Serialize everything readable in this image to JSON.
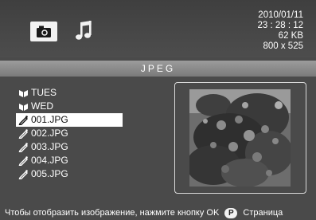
{
  "header": {
    "tabs": [
      {
        "icon": "camera-icon",
        "active": true
      },
      {
        "icon": "music-note-icon",
        "active": false
      }
    ],
    "date": "2010/01/11",
    "time": "23 : 28 : 12",
    "size": "62 KB",
    "resolution": "800 x 525"
  },
  "title": "JPEG",
  "files": [
    {
      "icon": "folder-icon",
      "label": "TUES"
    },
    {
      "icon": "folder-icon",
      "label": "WED"
    },
    {
      "icon": "image-file-icon",
      "label": "001.JPG",
      "selected": true
    },
    {
      "icon": "image-file-icon",
      "label": "002.JPG"
    },
    {
      "icon": "image-file-icon",
      "label": "003.JPG"
    },
    {
      "icon": "image-file-icon",
      "label": "004.JPG"
    },
    {
      "icon": "image-file-icon",
      "label": "005.JPG"
    }
  ],
  "footer": {
    "text": "Чтобы отобразить изображение, нажмите кнопку OK",
    "key": "P",
    "key_label": "Страница"
  }
}
